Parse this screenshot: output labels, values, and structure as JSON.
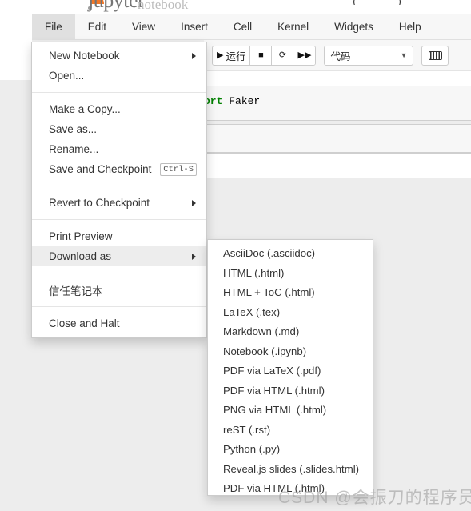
{
  "app": {
    "logo_text": "jupyter",
    "logo_sub": "notebook",
    "header_right": "—————  ———  (————)"
  },
  "menubar": {
    "items": [
      {
        "label": "File",
        "active": true
      },
      {
        "label": "Edit",
        "active": false
      },
      {
        "label": "View",
        "active": false
      },
      {
        "label": "Insert",
        "active": false
      },
      {
        "label": "Cell",
        "active": false
      },
      {
        "label": "Kernel",
        "active": false
      },
      {
        "label": "Widgets",
        "active": false
      },
      {
        "label": "Help",
        "active": false
      }
    ]
  },
  "toolbar": {
    "run_label": "运行",
    "run_glyph": "▶",
    "stop_glyph": "■",
    "restart_glyph": "⟳",
    "restart_run_glyph": "▶▶",
    "cell_type_value": "代码",
    "cell_type_chevron": "⌄",
    "keyboard_icon": "keyboard-icon"
  },
  "notebook": {
    "cells": [
      {
        "type": "code",
        "code_keyword": "ort",
        "code_rest": " Faker"
      }
    ]
  },
  "file_menu": {
    "groups": [
      {
        "items": [
          {
            "label": "New Notebook",
            "submenu": true,
            "shortcut": "",
            "highlighted": false
          },
          {
            "label": "Open...",
            "submenu": false,
            "shortcut": "",
            "highlighted": false
          }
        ]
      },
      {
        "items": [
          {
            "label": "Make a Copy...",
            "submenu": false,
            "shortcut": "",
            "highlighted": false
          },
          {
            "label": "Save as...",
            "submenu": false,
            "shortcut": "",
            "highlighted": false
          },
          {
            "label": "Rename...",
            "submenu": false,
            "shortcut": "",
            "highlighted": false
          },
          {
            "label": "Save and Checkpoint",
            "submenu": false,
            "shortcut": "Ctrl-S",
            "highlighted": false
          }
        ]
      },
      {
        "items": [
          {
            "label": "Revert to Checkpoint",
            "submenu": true,
            "shortcut": "",
            "highlighted": false
          }
        ]
      },
      {
        "items": [
          {
            "label": "Print Preview",
            "submenu": false,
            "shortcut": "",
            "highlighted": false
          },
          {
            "label": "Download as",
            "submenu": true,
            "shortcut": "",
            "highlighted": true
          }
        ]
      },
      {
        "items": [
          {
            "label": "信任笔记本",
            "submenu": false,
            "shortcut": "",
            "highlighted": false
          }
        ]
      },
      {
        "items": [
          {
            "label": "Close and Halt",
            "submenu": false,
            "shortcut": "",
            "highlighted": false
          }
        ]
      }
    ]
  },
  "download_submenu": {
    "items": [
      {
        "label": "AsciiDoc (.asciidoc)"
      },
      {
        "label": "HTML (.html)"
      },
      {
        "label": "HTML + ToC (.html)"
      },
      {
        "label": "LaTeX (.tex)"
      },
      {
        "label": "Markdown (.md)"
      },
      {
        "label": "Notebook (.ipynb)"
      },
      {
        "label": "PDF via LaTeX (.pdf)"
      },
      {
        "label": "PDF via HTML (.html)"
      },
      {
        "label": "PNG via HTML (.html)"
      },
      {
        "label": "reST (.rst)"
      },
      {
        "label": "Python (.py)"
      },
      {
        "label": "Reveal.js slides (.slides.html)"
      },
      {
        "label": "PDF via HTML (.html)"
      }
    ]
  },
  "watermark": {
    "text": "CSDN @会振刀的程序员"
  },
  "colors": {
    "accent": "#f37726",
    "menu_active_bg": "#e0e0e0",
    "page_bg": "#ededed",
    "code_keyword": "#008000"
  }
}
